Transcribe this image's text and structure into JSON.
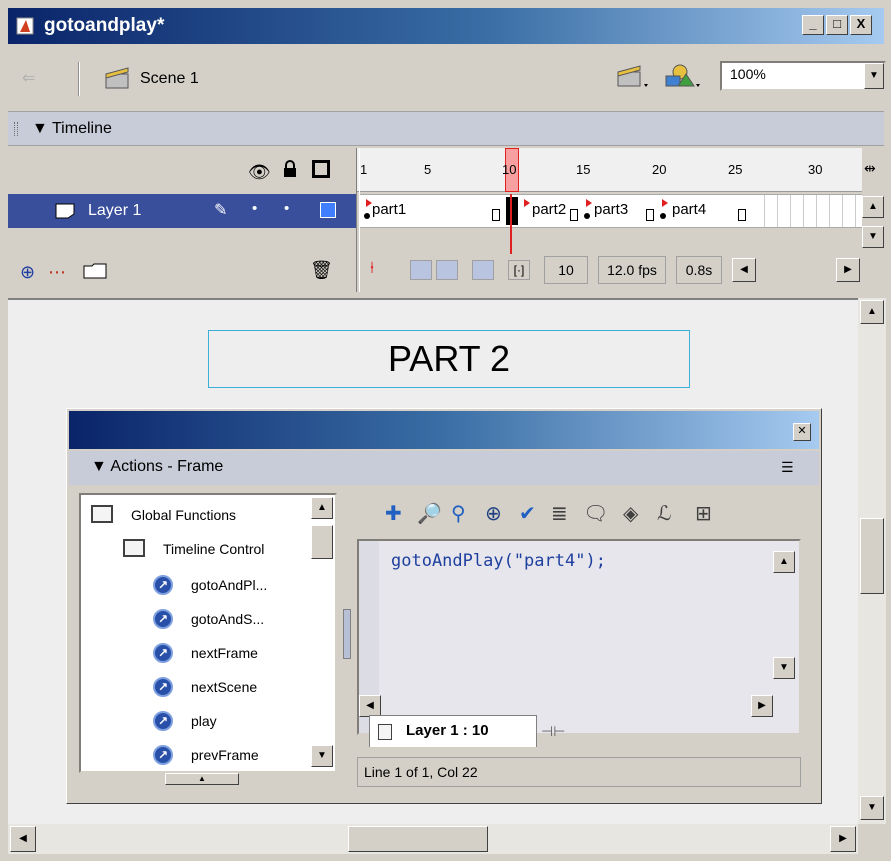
{
  "window": {
    "title": "gotoandplay*",
    "controls": [
      "_",
      "□",
      "X"
    ]
  },
  "editbar": {
    "scene_label": "Scene 1",
    "zoom": "100%"
  },
  "timeline": {
    "title": "Timeline",
    "ruler_ticks": [
      "1",
      "5",
      "10",
      "15",
      "20",
      "25",
      "30"
    ],
    "layer_name": "Layer 1",
    "frame_labels": [
      "part1",
      "part2",
      "part3",
      "part4"
    ],
    "current_frame": "10",
    "fps": "12.0 fps",
    "elapsed": "0.8s"
  },
  "stage": {
    "text": "PART 2"
  },
  "actions": {
    "title": "Actions - Frame",
    "toolbox": {
      "category": "Global Functions",
      "subcategory": "Timeline Control",
      "items": [
        "gotoAndPl...",
        "gotoAndS...",
        "nextFrame",
        "nextScene",
        "play",
        "prevFrame"
      ]
    },
    "script": "gotoAndPlay(\"part4\");",
    "tab_label": "Layer 1 : 10",
    "status": "Line 1 of 1, Col 22"
  }
}
